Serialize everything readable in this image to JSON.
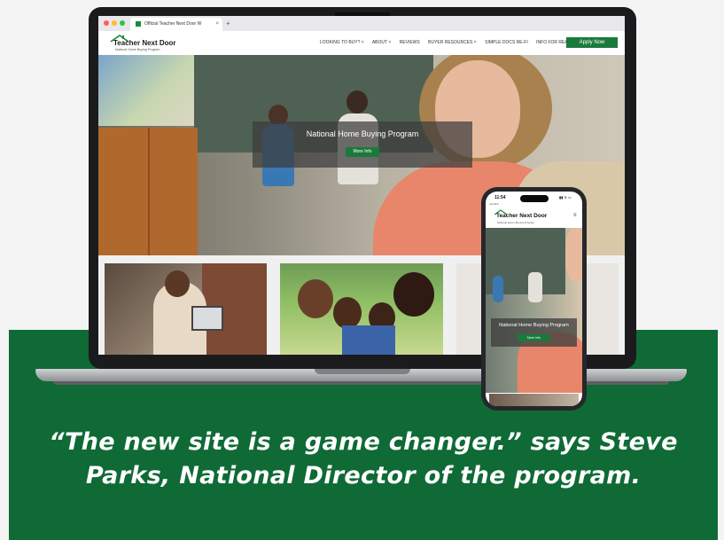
{
  "browser": {
    "tab_title": "Official Teacher Next Door W",
    "tab_close": "×",
    "new_tab": "+"
  },
  "site": {
    "logo_title": "Teacher Next Door",
    "logo_tagline": "National Home Buying Program",
    "nav": [
      {
        "label": "LOOKING TO BUY? ˅"
      },
      {
        "label": "ABOUT ˅"
      },
      {
        "label": "REVIEWS"
      },
      {
        "label": "BUYER RESOURCES ˅"
      },
      {
        "label": "SIMPLE DOCS RE-FI"
      },
      {
        "label": "INFO FOR REALTORS® ˅"
      }
    ],
    "apply_label": "Apply Now",
    "hero_title": "National Home Buying Program",
    "hero_button": "More Info"
  },
  "phone": {
    "time": "11:54",
    "carrier": "◂ Airbnb",
    "status_icons": "▮▮ ≋ ▭",
    "logo_title": "Teacher Next Door",
    "logo_tagline": "National Home Buying Program",
    "menu_icon": "≡",
    "hero_title": "National Home Buying Program",
    "hero_button": "More Info"
  },
  "caption": "“The new site is a game changer.” says Steve Parks, National Director of the program.",
  "colors": {
    "brand_green": "#0f6a35",
    "button_green": "#1a7a3c",
    "background": "#f4f4f4"
  }
}
